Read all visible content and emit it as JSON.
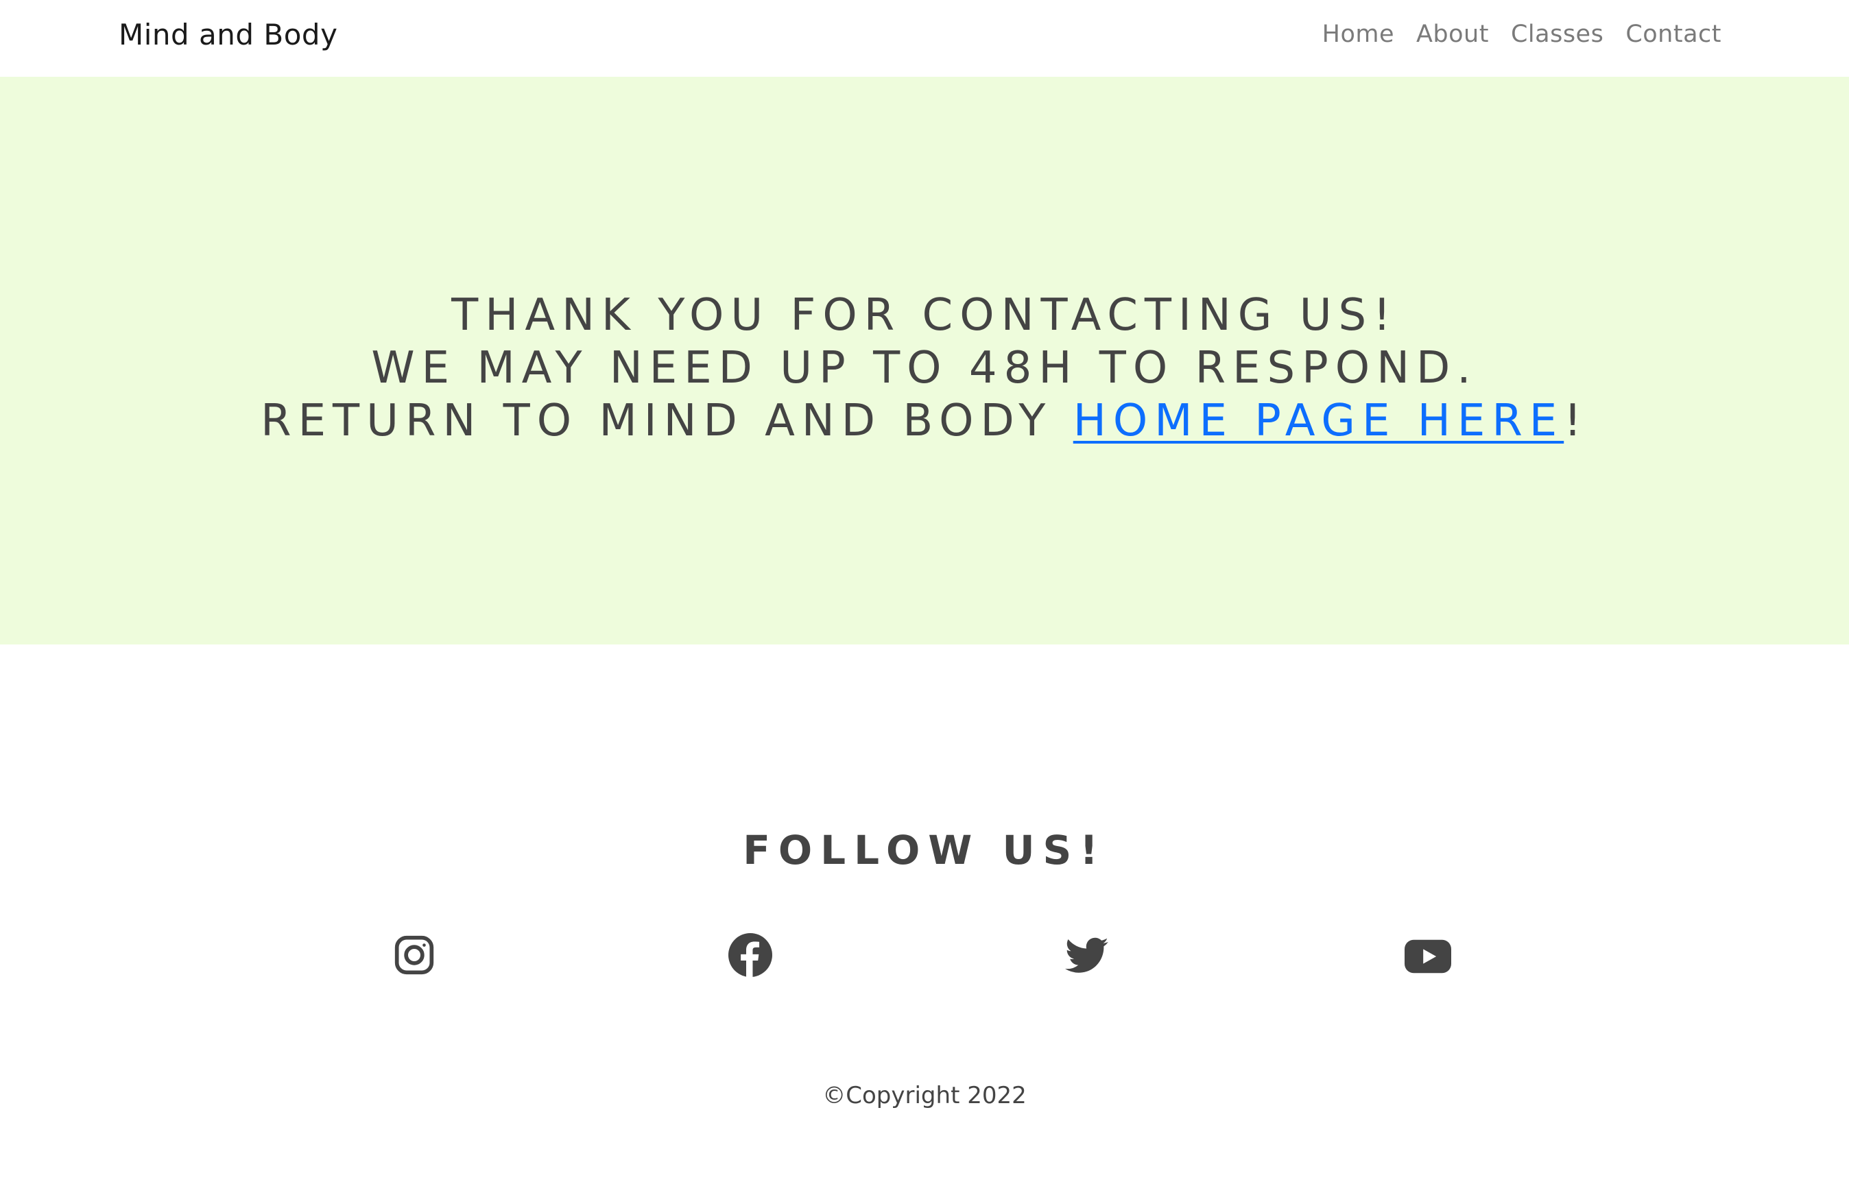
{
  "navbar": {
    "brand": "Mind and Body",
    "links": [
      "Home",
      "About",
      "Classes",
      "Contact"
    ]
  },
  "hero": {
    "line1": "THANK YOU FOR CONTACTING US!",
    "line2": "WE MAY NEED UP TO 48H TO RESPOND.",
    "line3_prefix": "RETURN TO MIND AND BODY ",
    "line3_link": "HOME PAGE HERE",
    "line3_suffix": "!"
  },
  "follow": {
    "title": "FOLLOW US!",
    "icons": [
      "instagram-icon",
      "facebook-icon",
      "twitter-icon",
      "youtube-icon"
    ]
  },
  "footer": {
    "copyright": "©Copyright 2022"
  },
  "colors": {
    "hero_background": "#eefcdc",
    "text": "#444444",
    "link": "#0d6efd",
    "nav_link": "#7a7a7a"
  }
}
